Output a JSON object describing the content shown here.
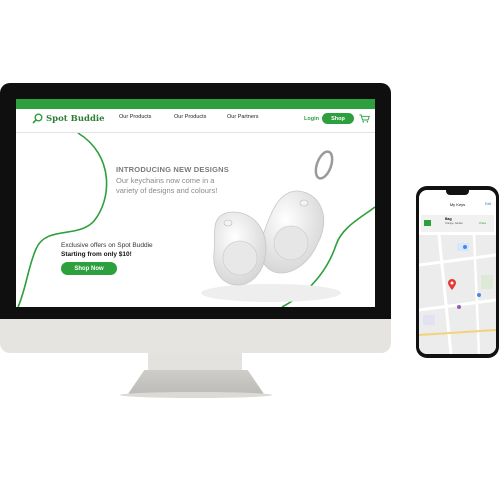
{
  "website": {
    "brand": "Spot Buddie",
    "nav": [
      "Our Products",
      "Our Products",
      "Our Partners"
    ],
    "login": "Login",
    "shop": "Shop",
    "hero_title": "INTRODUCING NEW DESIGNS",
    "hero_subtitle": "Our keychains now come in a variety of designs and colours!",
    "offer_line1": "Exclusive offers on Spot Buddie",
    "offer_line2": "Starting from only $10!",
    "cta": "Shop Now",
    "colors": {
      "brand_green": "#2d9f3d",
      "text_gray": "#8a8a8a"
    },
    "icons": [
      "magnifier-logo-icon",
      "cart-icon"
    ]
  },
  "phone_app": {
    "title": "My Keys",
    "edit": "Edit",
    "item_name": "Bag",
    "item_location": "Orange, Garden",
    "item_status": "Online",
    "map_label": "Beansfield",
    "icons": [
      "map-pin-icon"
    ]
  }
}
